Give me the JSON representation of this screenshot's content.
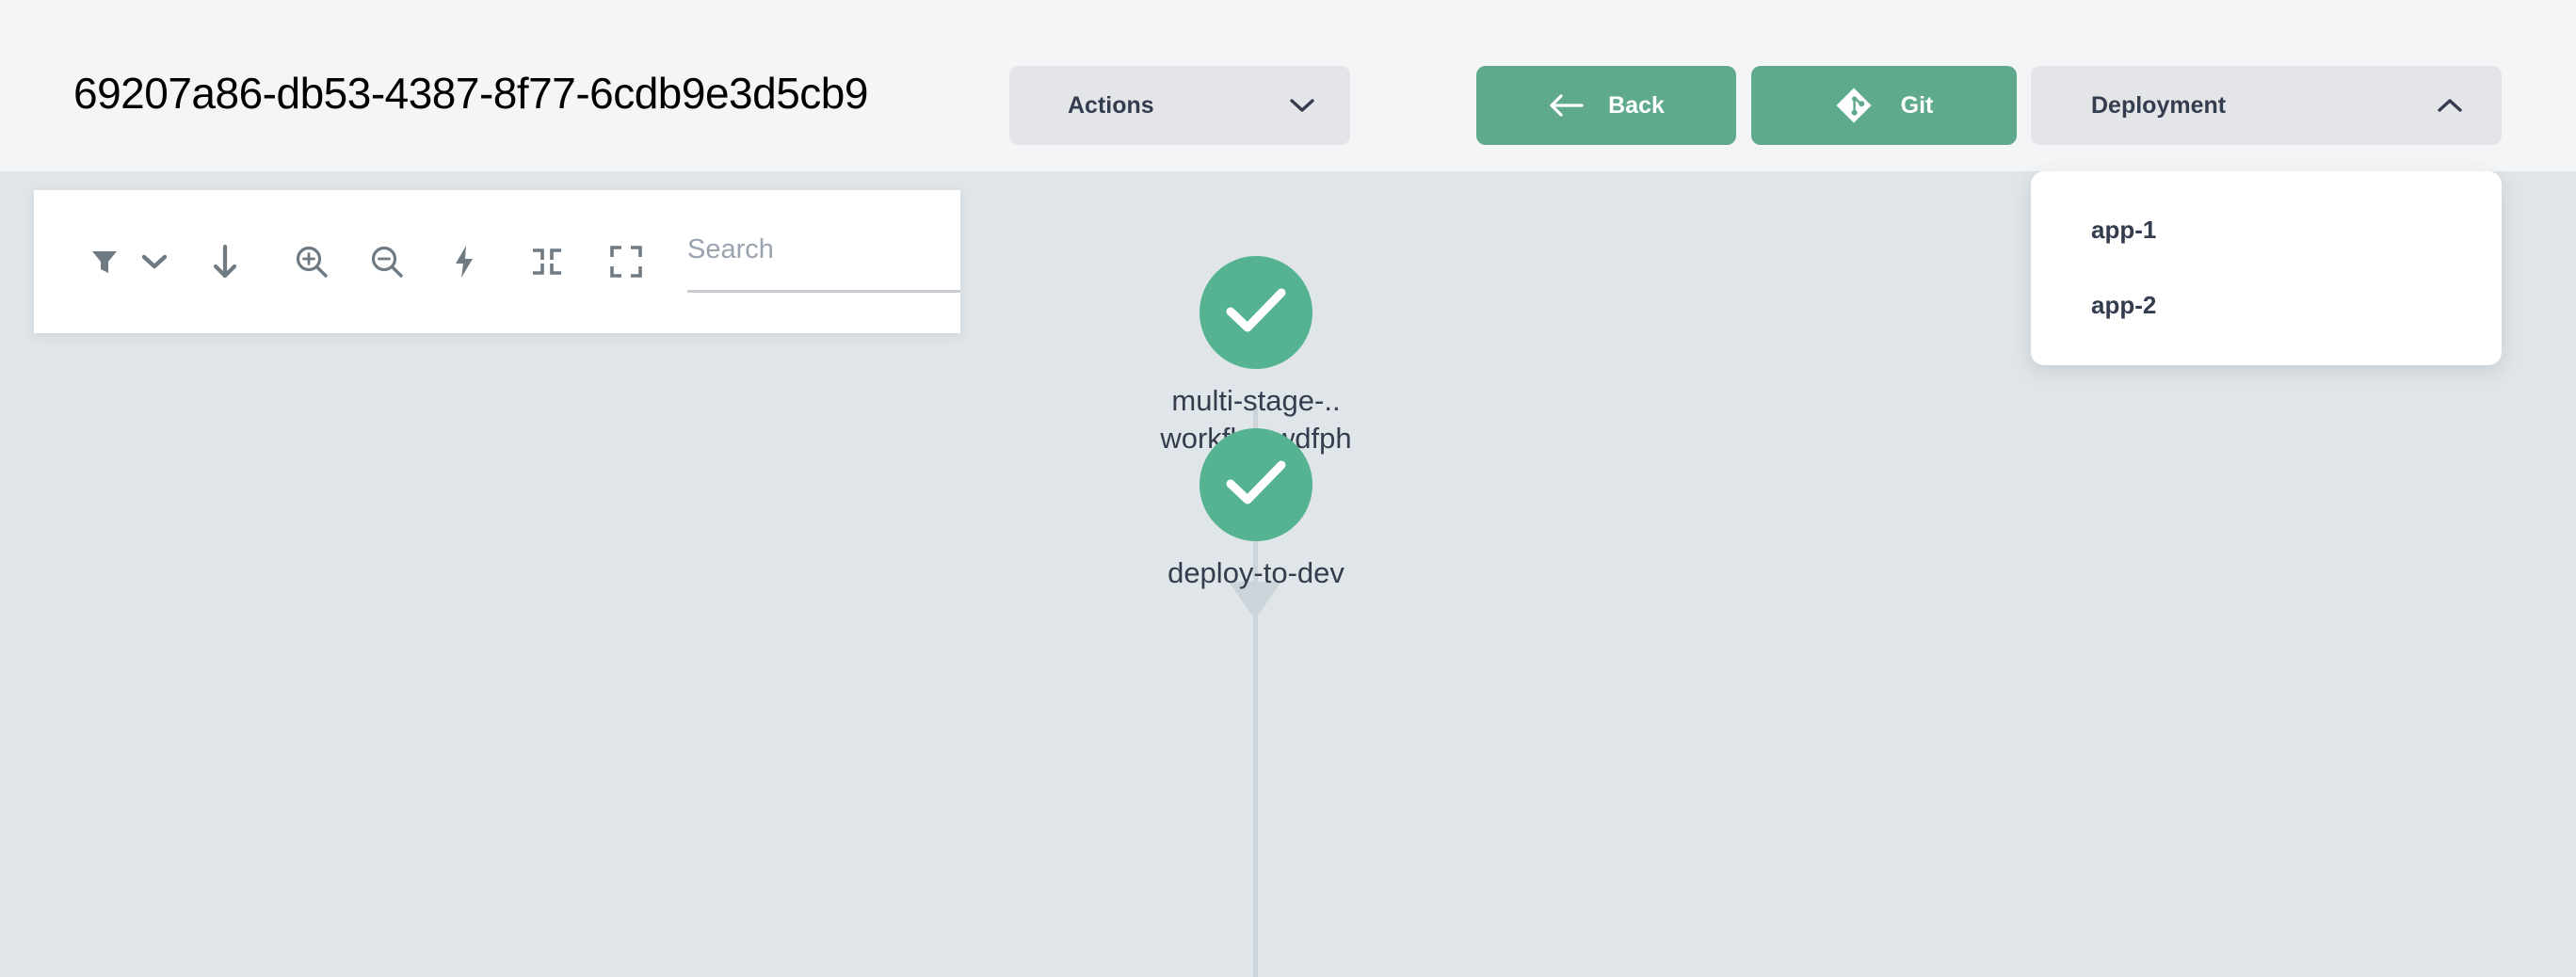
{
  "header": {
    "title": "69207a86-db53-4387-8f77-6cdb9e3d5cb9",
    "background_color": "#f4f5f7",
    "buttons": {
      "actions": {
        "label": "Actions",
        "icon": "chevron-down-icon",
        "style": "grey"
      },
      "back": {
        "label": "Back",
        "icon": "arrow-left-icon",
        "style": "green"
      },
      "git": {
        "label": "Git",
        "icon": "git-icon",
        "style": "green"
      },
      "deployment": {
        "label": "Deployment",
        "icon": "chevron-up-icon",
        "style": "grey",
        "expanded": true
      }
    }
  },
  "deployment_dropdown": {
    "open": true,
    "items": [
      {
        "label": "app-1"
      },
      {
        "label": "app-2"
      }
    ]
  },
  "toolbar": {
    "buttons": [
      {
        "name": "filter-icon",
        "title": "Filter"
      },
      {
        "name": "chevron-down-icon",
        "title": "Filter options"
      },
      {
        "name": "arrow-down-icon",
        "title": "Sort descending"
      },
      {
        "name": "zoom-in-icon",
        "title": "Zoom in"
      },
      {
        "name": "zoom-out-icon",
        "title": "Zoom out"
      },
      {
        "name": "bolt-icon",
        "title": "Quick actions"
      },
      {
        "name": "collapse-icon",
        "title": "Collapse"
      },
      {
        "name": "fullscreen-icon",
        "title": "Fullscreen"
      }
    ],
    "search": {
      "placeholder": "Search",
      "value": ""
    }
  },
  "graph": {
    "background_color": "#dfe5e8",
    "node_color": "#55b391",
    "edge_color": "#ccd4d9",
    "nodes": [
      {
        "label": "multi-stage-..\nworkflowwdfph",
        "status": "succeeded",
        "icon": "check-icon"
      },
      {
        "label": "deploy-to-dev",
        "status": "succeeded",
        "icon": "check-icon"
      }
    ]
  },
  "colors": {
    "accent_green": "#5faa8c",
    "node_green": "#55b391",
    "button_grey": "#e3e5e9",
    "text_dark": "#333d4d",
    "canvas": "#dfe5e8",
    "header": "#f4f5f7"
  }
}
